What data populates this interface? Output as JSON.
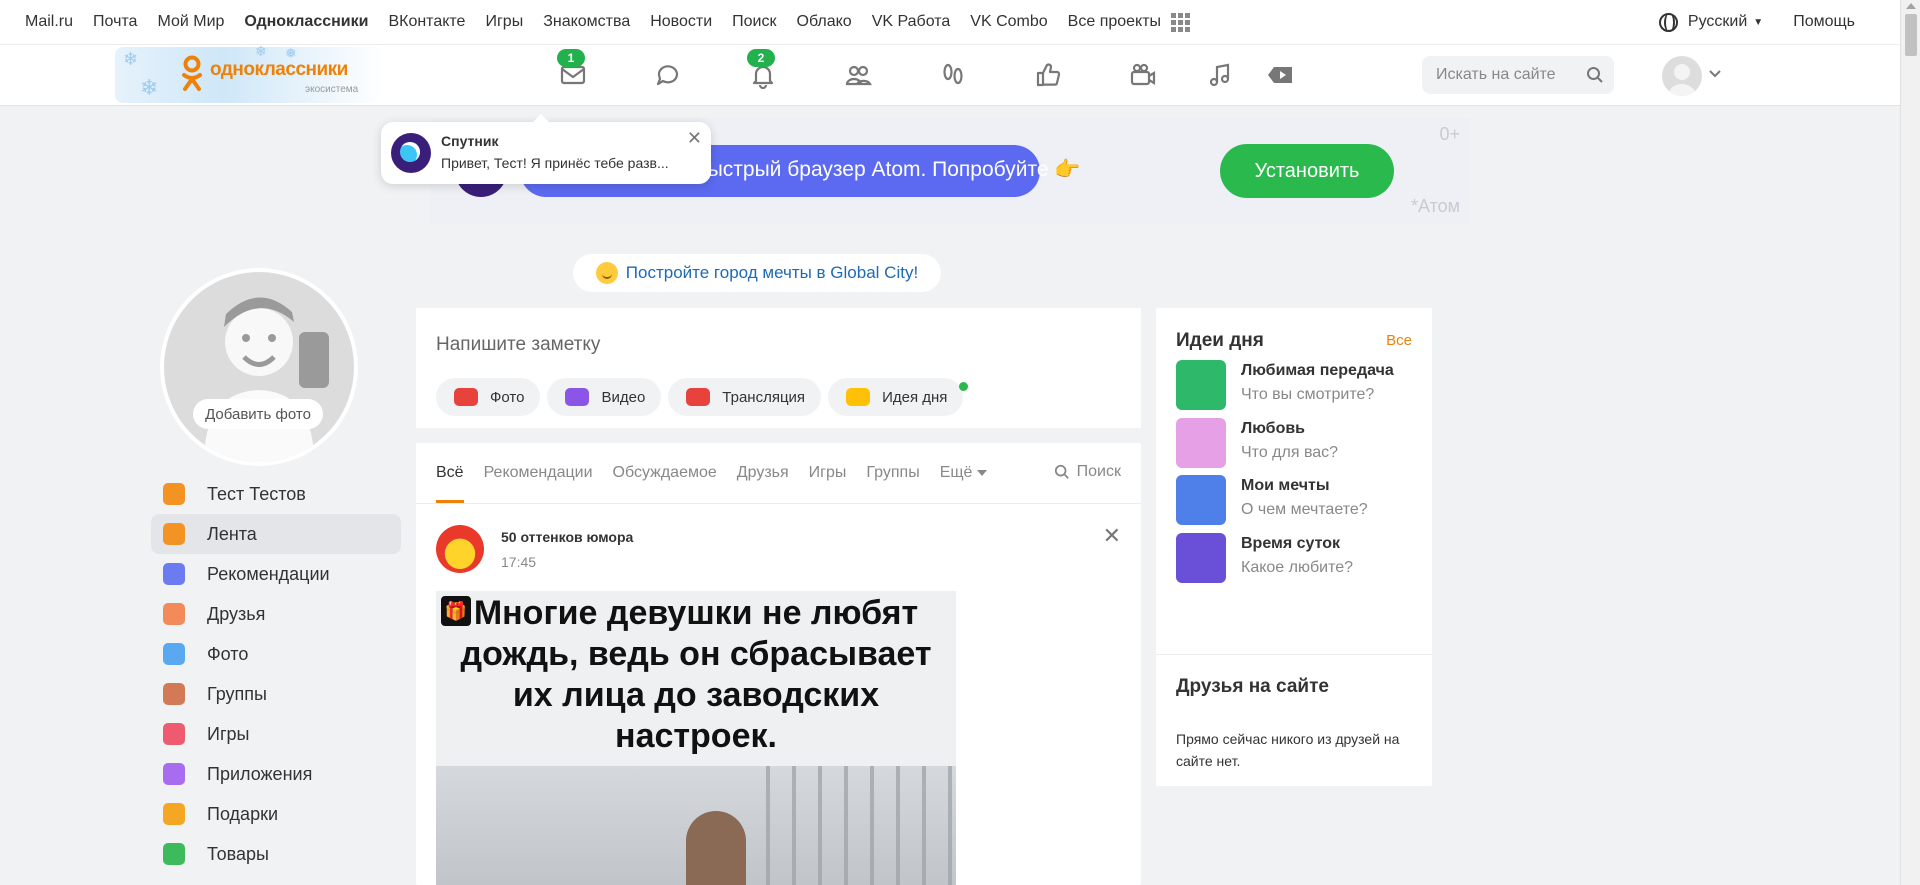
{
  "portal": {
    "links": [
      "Mail.ru",
      "Почта",
      "Мой Мир",
      "Одноклассники",
      "ВКонтакте",
      "Игры",
      "Знакомства",
      "Новости",
      "Поиск",
      "Облако",
      "VK Работа",
      "VK Combo",
      "Все проекты"
    ],
    "active_link": "Одноклассники",
    "language": "Русский",
    "help": "Помощь"
  },
  "header": {
    "logo_name": "одноклассники",
    "logo_sub": "экосистема",
    "badges": {
      "messages": "1",
      "notifications": "2"
    },
    "search_placeholder": "Искать на сайте",
    "nav_icons": [
      "mail-icon",
      "discussions-icon",
      "bell-icon",
      "friends-icon",
      "guests-icon",
      "likes-icon",
      "video-camera-icon",
      "music-icon",
      "video-play-icon"
    ]
  },
  "toast": {
    "title": "Спутник",
    "text": "Привет, Тест! Я принёс тебе разв..."
  },
  "banner": {
    "text": "Новый быстрый браузер Atom. Попробуйте 👉",
    "button": "Установить",
    "age": "0+",
    "brand": "*Атом"
  },
  "global_city": "Постройте город мечты в Global City!",
  "profile": {
    "add_photo": "Добавить фото"
  },
  "menu": [
    {
      "label": "Тест Тестов",
      "icon": "user-icon",
      "color": "#f29324"
    },
    {
      "label": "Лента",
      "icon": "feed-icon",
      "color": "#f29324",
      "active": true
    },
    {
      "label": "Рекомендации",
      "icon": "compass-icon",
      "color": "#6b7bf0"
    },
    {
      "label": "Друзья",
      "icon": "friends-icon",
      "color": "#f28a5a"
    },
    {
      "label": "Фото",
      "icon": "photo-icon",
      "color": "#5aa9f0"
    },
    {
      "label": "Группы",
      "icon": "groups-icon",
      "color": "#d27a55"
    },
    {
      "label": "Игры",
      "icon": "gamepad-icon",
      "color": "#ee5a6f"
    },
    {
      "label": "Приложения",
      "icon": "apps-icon",
      "color": "#a86cf0"
    },
    {
      "label": "Подарки",
      "icon": "gift-icon",
      "color": "#f5a623"
    },
    {
      "label": "Товары",
      "icon": "shopping-bag-icon",
      "color": "#3dbb5c"
    }
  ],
  "composer": {
    "placeholder": "Напишите заметку",
    "actions": [
      {
        "label": "Фото",
        "color": "#e8423c"
      },
      {
        "label": "Видео",
        "color": "#8b55e8"
      },
      {
        "label": "Трансляция",
        "color": "#e8423c"
      },
      {
        "label": "Идея дня",
        "color": "#ffc107"
      }
    ]
  },
  "feed": {
    "tabs": [
      "Всё",
      "Рекомендации",
      "Обсуждаемое",
      "Друзья",
      "Игры",
      "Группы",
      "Ещё"
    ],
    "active_tab": "Всё",
    "search": "Поиск",
    "post": {
      "author": "50 оттенков юмора",
      "time": "17:45",
      "image_text": "Многие девушки не любят дождь, ведь он сбрасывает их лица до заводских настроек."
    }
  },
  "ideas": {
    "title": "Идеи дня",
    "all": "Все",
    "items": [
      {
        "title": "Любимая передача",
        "subtitle": "Что вы смотрите?",
        "color": "#2db86a"
      },
      {
        "title": "Любовь",
        "subtitle": "Что для вас?",
        "color": "#e6a0e6"
      },
      {
        "title": "Мои мечты",
        "subtitle": "О чем мечтаете?",
        "color": "#4f7fe8"
      },
      {
        "title": "Время суток",
        "subtitle": "Какое любите?",
        "color": "#6a4fd8"
      }
    ],
    "friends_title": "Друзья на сайте",
    "friends_text": "Прямо сейчас никого из друзей на сайте нет."
  }
}
